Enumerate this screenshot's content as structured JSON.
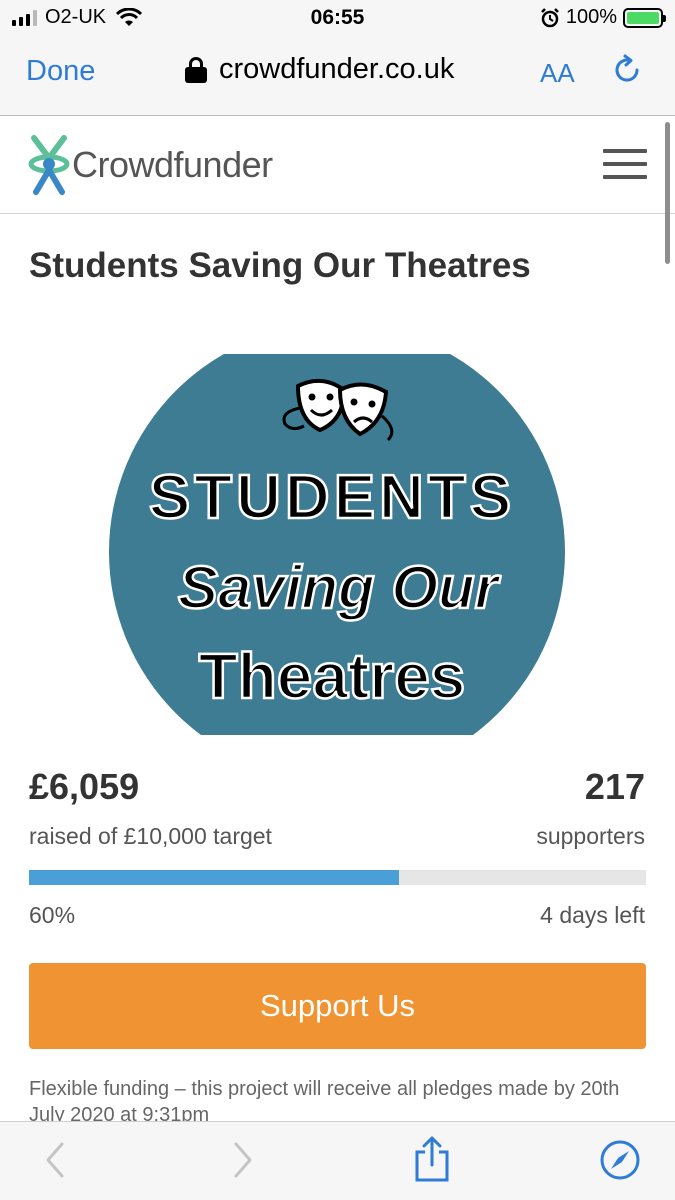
{
  "status_bar": {
    "carrier": "O2-UK",
    "time": "06:55",
    "battery": "100%"
  },
  "browser": {
    "done_label": "Done",
    "url": "crowdfunder.co.uk",
    "text_size_label": "AA"
  },
  "site": {
    "logo_text": "Crowdfunder"
  },
  "project": {
    "title": "Students Saving Our Theatres",
    "image_text": {
      "line1": "STUDENTS",
      "line2": "Saving Our",
      "line3": "Theatres"
    },
    "image_color": "#3d7c93",
    "amount_raised": "£6,059",
    "target_label": "raised of £10,000 target",
    "supporters_count": "217",
    "supporters_label": "supporters",
    "progress_fraction": 0.6,
    "percent_label": "60%",
    "days_left": "4 days left",
    "support_button": "Support Us",
    "funding_note": "Flexible funding – this project will receive all pledges made by 20th July 2020 at 9:31pm"
  },
  "colors": {
    "accent_blue": "#2f7cd6",
    "progress_blue": "#4a9fd8",
    "support_orange": "#f09433",
    "logo_teal": "#5bbf9a",
    "logo_blue": "#3a87c8"
  },
  "icons": [
    "signal-icon",
    "wifi-icon",
    "alarm-icon",
    "battery-icon",
    "lock-icon",
    "reload-icon",
    "hamburger-icon",
    "back-icon",
    "forward-icon",
    "share-icon",
    "compass-icon"
  ]
}
